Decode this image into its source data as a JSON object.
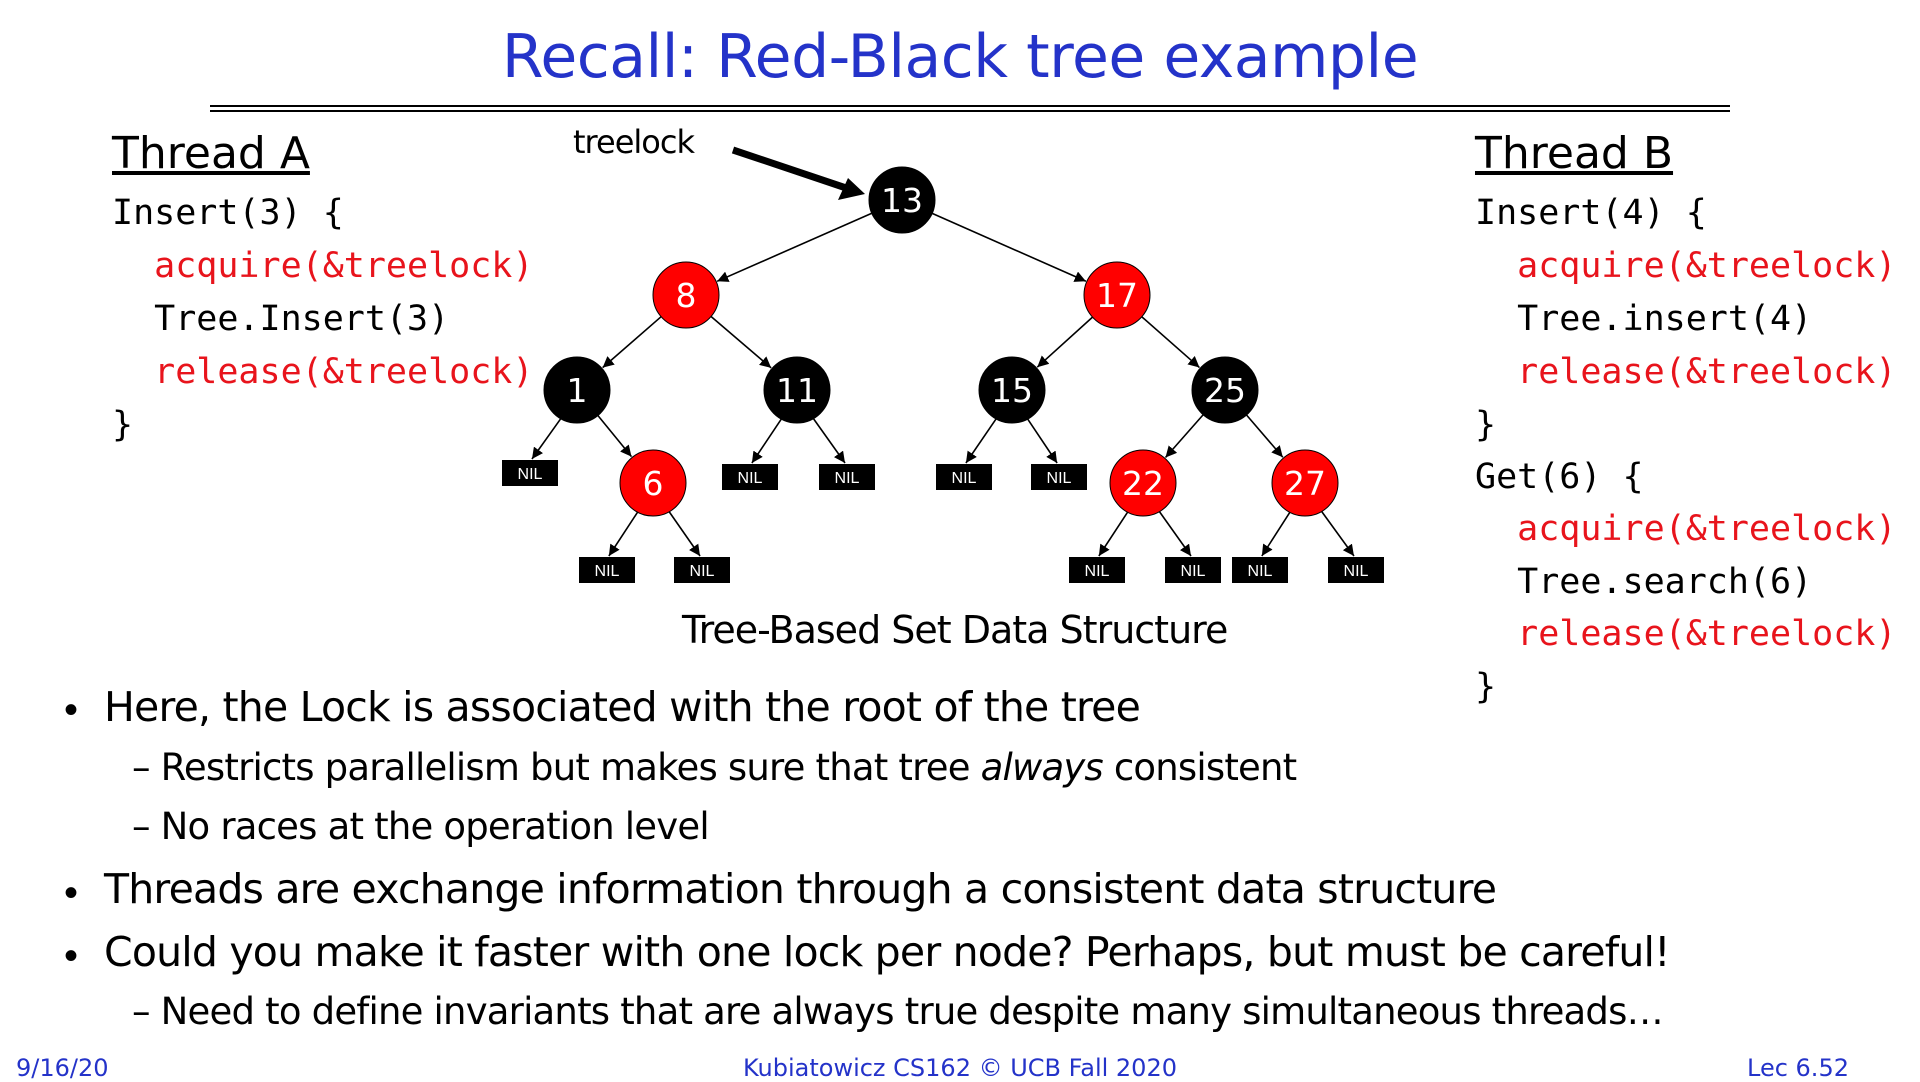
{
  "slide": {
    "title": "Recall: Red-Black tree example",
    "footer": {
      "date": "9/16/20",
      "course": "Kubiatowicz CS162 © UCB Fall 2020",
      "lecture": "Lec 6.52"
    }
  },
  "thread_a": {
    "heading": "Thread A",
    "lines": [
      "Insert(3) {",
      "  acquire(&treelock)",
      "  Tree.Insert(3)",
      "  release(&treelock)",
      "}"
    ]
  },
  "thread_b": {
    "heading": "Thread B",
    "lines": [
      "Insert(4) {",
      "  acquire(&treelock)",
      "  Tree.insert(4)",
      "  release(&treelock)",
      "}",
      "Get(6) {",
      "  acquire(&treelock)",
      "  Tree.search(6)",
      "  release(&treelock)",
      "}"
    ]
  },
  "diagram": {
    "pointer_label": "treelock",
    "caption": "Tree-Based Set Data Structure",
    "nil_label": "NIL",
    "colors": {
      "red": "#ff0000",
      "black": "#000000"
    },
    "nodes": [
      {
        "id": "n13",
        "label": "13",
        "color": "black"
      },
      {
        "id": "n8",
        "label": "8",
        "color": "red"
      },
      {
        "id": "n17",
        "label": "17",
        "color": "red"
      },
      {
        "id": "n1",
        "label": "1",
        "color": "black"
      },
      {
        "id": "n11",
        "label": "11",
        "color": "black"
      },
      {
        "id": "n15",
        "label": "15",
        "color": "black"
      },
      {
        "id": "n25",
        "label": "25",
        "color": "black"
      },
      {
        "id": "n6",
        "label": "6",
        "color": "red"
      },
      {
        "id": "n22",
        "label": "22",
        "color": "red"
      },
      {
        "id": "n27",
        "label": "27",
        "color": "red"
      }
    ]
  },
  "bullets": {
    "b1": "Here, the Lock is associated with the root of the tree",
    "b1_s1_a": "Restricts parallelism but makes sure that tree ",
    "b1_s1_em": "always",
    "b1_s1_b": " consistent",
    "b1_s2": "No races at the operation level",
    "b2": "Threads are exchange information through a consistent data structure",
    "b3": "Could you make it faster with one lock per node?  Perhaps, but must be careful!",
    "b3_s1": "Need to define invariants that are always true despite many simultaneous threads…"
  }
}
